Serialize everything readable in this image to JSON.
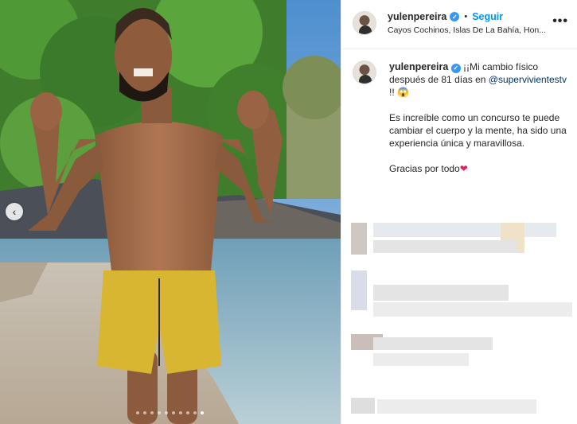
{
  "header": {
    "username": "yulenpereira",
    "separator": "•",
    "follow_label": "Seguir",
    "location": "Cayos Cochinos, Islas De La Bahía, Hon...",
    "more_label": "•••"
  },
  "caption": {
    "username": "yulenpereira",
    "line1": "¡¡Mi cambio físico después de 81 días en",
    "mention": "@supervivientestv",
    "line1_end": " !! 😱",
    "paragraph2": "Es increíble como un concurso te puede cambiar el cuerpo y la mente, ha sido una experiencia única y maravillosa.",
    "paragraph3": "Gracias por todo",
    "heart": "❤"
  },
  "media": {
    "prev_label": "‹",
    "carousel_count": 10,
    "carousel_active_index": 9
  },
  "colors": {
    "accent": "#0095f6",
    "verified": "#3897f0",
    "mention": "#00376b"
  }
}
